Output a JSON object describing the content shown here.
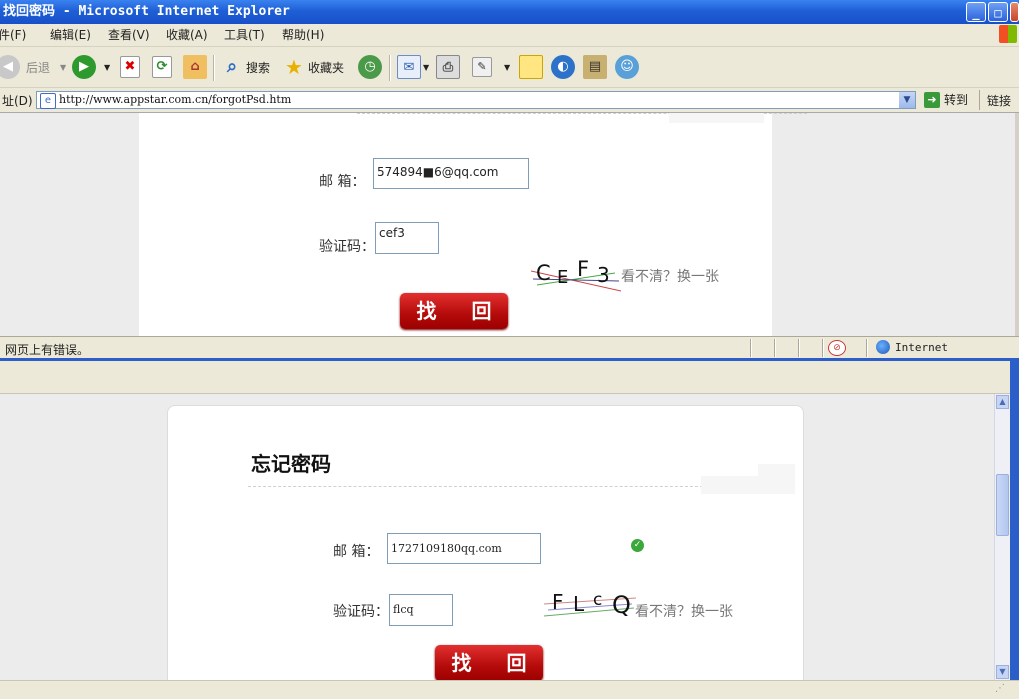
{
  "window": {
    "title": "找回密码 - Microsoft Internet Explorer",
    "min": "_",
    "max": "□",
    "close": "✕"
  },
  "menu": [
    "文件(F)",
    "编辑(E)",
    "查看(V)",
    "收藏(A)",
    "工具(T)",
    "帮助(H)"
  ],
  "toolbar": {
    "back": "后退",
    "search": "搜索",
    "favorites": "收藏夹"
  },
  "address": {
    "label": "地址(D)",
    "url": "http://www.appstar.com.cn/forgotPsd.htm",
    "go": "转到",
    "links": "链接"
  },
  "form_top": {
    "email_label": "邮  箱：",
    "email_value": "574894■6@qq.com",
    "code_label": "验证码：",
    "code_value": "cef3",
    "captcha": [
      "C",
      "E",
      "F",
      "3"
    ],
    "refresh": "看不清？换一张",
    "submit": "找 回"
  },
  "status": {
    "text": "网页上有错误。",
    "zone": "Internet"
  },
  "form_bottom": {
    "heading": "忘记密码",
    "email_label": "邮  箱：",
    "email_value": "1727109180qq.com",
    "code_label": "验证码：",
    "code_value": "flcq",
    "captcha": [
      "F",
      "L",
      "c",
      "Q"
    ],
    "refresh": "看不清？换一张",
    "submit": "找 回"
  }
}
